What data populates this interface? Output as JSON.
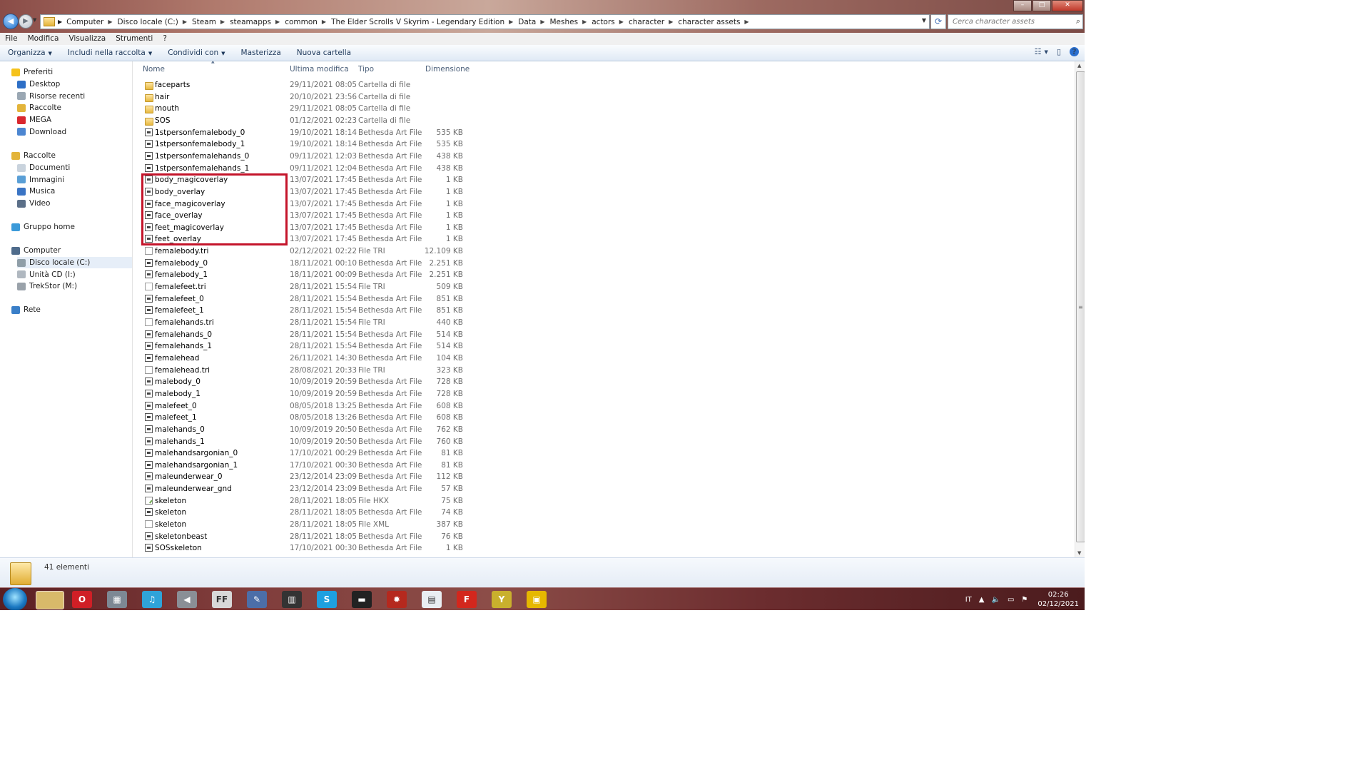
{
  "window": {
    "breadcrumbs": [
      "Computer",
      "Disco locale (C:)",
      "Steam",
      "steamapps",
      "common",
      "The Elder Scrolls V Skyrim - Legendary Edition",
      "Data",
      "Meshes",
      "actors",
      "character",
      "character assets"
    ],
    "search_placeholder": "Cerca character assets"
  },
  "menu": [
    "File",
    "Modifica",
    "Visualizza",
    "Strumenti",
    "?"
  ],
  "commands": [
    {
      "label": "Organizza",
      "dropdown": true
    },
    {
      "label": "Includi nella raccolta",
      "dropdown": true
    },
    {
      "label": "Condividi con",
      "dropdown": true
    },
    {
      "label": "Masterizza",
      "dropdown": false
    },
    {
      "label": "Nuova cartella",
      "dropdown": false
    }
  ],
  "nav": {
    "favorites_header": "Preferiti",
    "favorites": [
      "Desktop",
      "Risorse recenti",
      "Raccolte",
      "MEGA",
      "Download"
    ],
    "libraries_header": "Raccolte",
    "libraries": [
      "Documenti",
      "Immagini",
      "Musica",
      "Video"
    ],
    "homegroup": "Gruppo home",
    "computer_header": "Computer",
    "drives": [
      "Disco locale (C:)",
      "Unità CD (I:)",
      "TrekStor (M:)"
    ],
    "network": "Rete"
  },
  "columns": {
    "name": "Nome",
    "date": "Ultima modifica",
    "type": "Tipo",
    "size": "Dimensione"
  },
  "files": [
    {
      "name": "faceparts",
      "date": "29/11/2021 08:05",
      "type": "Cartella di file",
      "size": "",
      "icon": "folder"
    },
    {
      "name": "hair",
      "date": "20/10/2021 23:56",
      "type": "Cartella di file",
      "size": "",
      "icon": "folder"
    },
    {
      "name": "mouth",
      "date": "29/11/2021 08:05",
      "type": "Cartella di file",
      "size": "",
      "icon": "folder"
    },
    {
      "name": "SOS",
      "date": "01/12/2021 02:23",
      "type": "Cartella di file",
      "size": "",
      "icon": "folder"
    },
    {
      "name": "1stpersonfemalebody_0",
      "date": "19/10/2021 18:14",
      "type": "Bethesda Art File",
      "size": "535 KB",
      "icon": "nif"
    },
    {
      "name": "1stpersonfemalebody_1",
      "date": "19/10/2021 18:14",
      "type": "Bethesda Art File",
      "size": "535 KB",
      "icon": "nif"
    },
    {
      "name": "1stpersonfemalehands_0",
      "date": "09/11/2021 12:03",
      "type": "Bethesda Art File",
      "size": "438 KB",
      "icon": "nif"
    },
    {
      "name": "1stpersonfemalehands_1",
      "date": "09/11/2021 12:04",
      "type": "Bethesda Art File",
      "size": "438 KB",
      "icon": "nif"
    },
    {
      "name": "body_magicoverlay",
      "date": "13/07/2021 17:45",
      "type": "Bethesda Art File",
      "size": "1 KB",
      "icon": "nif"
    },
    {
      "name": "body_overlay",
      "date": "13/07/2021 17:45",
      "type": "Bethesda Art File",
      "size": "1 KB",
      "icon": "nif"
    },
    {
      "name": "face_magicoverlay",
      "date": "13/07/2021 17:45",
      "type": "Bethesda Art File",
      "size": "1 KB",
      "icon": "nif"
    },
    {
      "name": "face_overlay",
      "date": "13/07/2021 17:45",
      "type": "Bethesda Art File",
      "size": "1 KB",
      "icon": "nif"
    },
    {
      "name": "feet_magicoverlay",
      "date": "13/07/2021 17:45",
      "type": "Bethesda Art File",
      "size": "1 KB",
      "icon": "nif"
    },
    {
      "name": "feet_overlay",
      "date": "13/07/2021 17:45",
      "type": "Bethesda Art File",
      "size": "1 KB",
      "icon": "nif"
    },
    {
      "name": "femalebody.tri",
      "date": "02/12/2021 02:22",
      "type": "File TRI",
      "size": "12.109 KB",
      "icon": "blank"
    },
    {
      "name": "femalebody_0",
      "date": "18/11/2021 00:10",
      "type": "Bethesda Art File",
      "size": "2.251 KB",
      "icon": "nif"
    },
    {
      "name": "femalebody_1",
      "date": "18/11/2021 00:09",
      "type": "Bethesda Art File",
      "size": "2.251 KB",
      "icon": "nif"
    },
    {
      "name": "femalefeet.tri",
      "date": "28/11/2021 15:54",
      "type": "File TRI",
      "size": "509 KB",
      "icon": "blank"
    },
    {
      "name": "femalefeet_0",
      "date": "28/11/2021 15:54",
      "type": "Bethesda Art File",
      "size": "851 KB",
      "icon": "nif"
    },
    {
      "name": "femalefeet_1",
      "date": "28/11/2021 15:54",
      "type": "Bethesda Art File",
      "size": "851 KB",
      "icon": "nif"
    },
    {
      "name": "femalehands.tri",
      "date": "28/11/2021 15:54",
      "type": "File TRI",
      "size": "440 KB",
      "icon": "blank"
    },
    {
      "name": "femalehands_0",
      "date": "28/11/2021 15:54",
      "type": "Bethesda Art File",
      "size": "514 KB",
      "icon": "nif"
    },
    {
      "name": "femalehands_1",
      "date": "28/11/2021 15:54",
      "type": "Bethesda Art File",
      "size": "514 KB",
      "icon": "nif"
    },
    {
      "name": "femalehead",
      "date": "26/11/2021 14:30",
      "type": "Bethesda Art File",
      "size": "104 KB",
      "icon": "nif"
    },
    {
      "name": "femalehead.tri",
      "date": "28/08/2021 20:33",
      "type": "File TRI",
      "size": "323 KB",
      "icon": "blank"
    },
    {
      "name": "malebody_0",
      "date": "10/09/2019 20:59",
      "type": "Bethesda Art File",
      "size": "728 KB",
      "icon": "nif"
    },
    {
      "name": "malebody_1",
      "date": "10/09/2019 20:59",
      "type": "Bethesda Art File",
      "size": "728 KB",
      "icon": "nif"
    },
    {
      "name": "malefeet_0",
      "date": "08/05/2018 13:25",
      "type": "Bethesda Art File",
      "size": "608 KB",
      "icon": "nif"
    },
    {
      "name": "malefeet_1",
      "date": "08/05/2018 13:26",
      "type": "Bethesda Art File",
      "size": "608 KB",
      "icon": "nif"
    },
    {
      "name": "malehands_0",
      "date": "10/09/2019 20:50",
      "type": "Bethesda Art File",
      "size": "762 KB",
      "icon": "nif"
    },
    {
      "name": "malehands_1",
      "date": "10/09/2019 20:50",
      "type": "Bethesda Art File",
      "size": "760 KB",
      "icon": "nif"
    },
    {
      "name": "malehandsargonian_0",
      "date": "17/10/2021 00:29",
      "type": "Bethesda Art File",
      "size": "81 KB",
      "icon": "nif"
    },
    {
      "name": "malehandsargonian_1",
      "date": "17/10/2021 00:30",
      "type": "Bethesda Art File",
      "size": "81 KB",
      "icon": "nif"
    },
    {
      "name": "maleunderwear_0",
      "date": "23/12/2014 23:09",
      "type": "Bethesda Art File",
      "size": "112 KB",
      "icon": "nif"
    },
    {
      "name": "maleunderwear_gnd",
      "date": "23/12/2014 23:09",
      "type": "Bethesda Art File",
      "size": "57 KB",
      "icon": "nif"
    },
    {
      "name": "skeleton",
      "date": "28/11/2021 18:05",
      "type": "File HKX",
      "size": "75 KB",
      "icon": "hkx"
    },
    {
      "name": "skeleton",
      "date": "28/11/2021 18:05",
      "type": "Bethesda Art File",
      "size": "74 KB",
      "icon": "nif"
    },
    {
      "name": "skeleton",
      "date": "28/11/2021 18:05",
      "type": "File XML",
      "size": "387 KB",
      "icon": "blank"
    },
    {
      "name": "skeletonbeast",
      "date": "28/11/2021 18:05",
      "type": "Bethesda Art File",
      "size": "76 KB",
      "icon": "nif"
    },
    {
      "name": "SOSskeleton",
      "date": "17/10/2021 00:30",
      "type": "Bethesda Art File",
      "size": "1 KB",
      "icon": "nif"
    }
  ],
  "status": {
    "count": "41 elementi"
  },
  "tray": {
    "lang": "IT",
    "time": "02:26",
    "date": "02/12/2021"
  },
  "taskbar_apps": [
    "explorer-icon",
    "opera-icon",
    "media-center-icon",
    "itunes-icon",
    "volume-app-icon",
    "ffdec-icon",
    "pen-icon",
    "film-icon",
    "skype-icon",
    "mmm-icon",
    "gear-app-icon",
    "window-app-icon",
    "f-app-icon",
    "y-app-icon",
    "box-app-icon"
  ],
  "colors": {
    "highlight": "#c4142a",
    "accent": "#1e395b"
  }
}
